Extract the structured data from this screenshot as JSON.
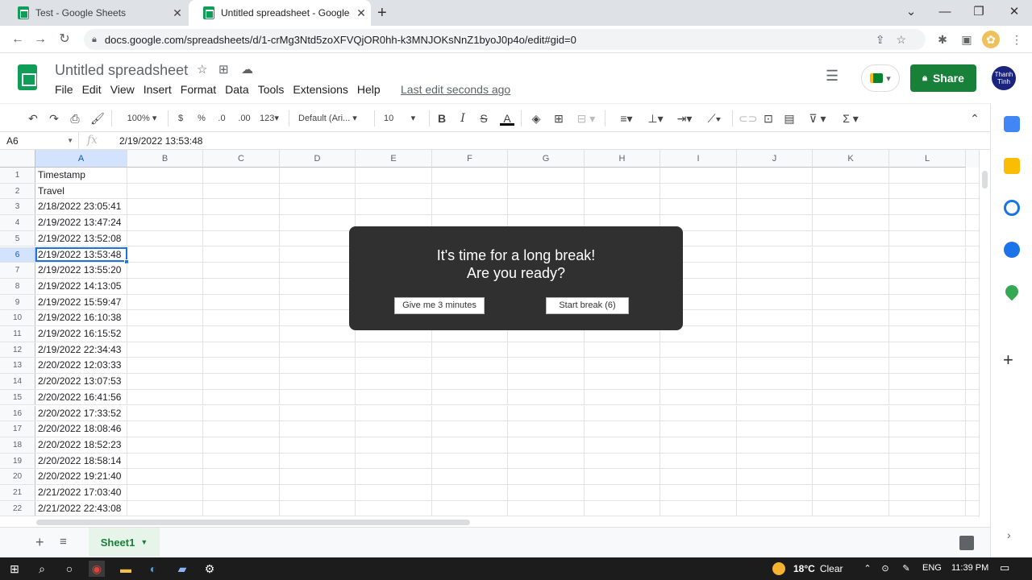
{
  "browser": {
    "tabs": [
      {
        "title": "Test - Google Sheets",
        "active": false
      },
      {
        "title": "Untitled spreadsheet - Google Sh",
        "active": true
      }
    ],
    "url": "docs.google.com/spreadsheets/d/1-crMg3Ntd5zoXFVQjOR0hh-k3MNJOKsNnZ1byoJ0p4o/edit#gid=0"
  },
  "sheets": {
    "title": "Untitled spreadsheet",
    "menu": [
      "File",
      "Edit",
      "View",
      "Insert",
      "Format",
      "Data",
      "Tools",
      "Extensions",
      "Help"
    ],
    "last_edit": "Last edit seconds ago",
    "share_label": "Share",
    "avatar_text": "Thanh Tình"
  },
  "toolbar": {
    "zoom": "100%",
    "currency": "$",
    "percent": "%",
    "dec_decrease": ".0",
    "dec_increase": ".00",
    "more_formats": "123",
    "font": "Default (Ari...",
    "font_size": "10",
    "bold": "B",
    "italic": "I",
    "strike": "S",
    "text_color": "A",
    "sum": "Σ"
  },
  "formula_bar": {
    "cell_ref": "A6",
    "fx": "fx",
    "value": "2/19/2022 13:53:48"
  },
  "grid": {
    "columns": [
      "A",
      "B",
      "C",
      "D",
      "E",
      "F",
      "G",
      "H",
      "I",
      "J",
      "K",
      "L"
    ],
    "selected_column": "A",
    "selected_row": 6,
    "rows": [
      {
        "num": "1",
        "a": "Timestamp"
      },
      {
        "num": "2",
        "a": "Travel"
      },
      {
        "num": "3",
        "a": "2/18/2022 23:05:41"
      },
      {
        "num": "4",
        "a": "2/19/2022 13:47:24"
      },
      {
        "num": "5",
        "a": "2/19/2022 13:52:08"
      },
      {
        "num": "6",
        "a": "2/19/2022 13:53:48"
      },
      {
        "num": "7",
        "a": "2/19/2022 13:55:20"
      },
      {
        "num": "8",
        "a": "2/19/2022 14:13:05"
      },
      {
        "num": "9",
        "a": "2/19/2022 15:59:47"
      },
      {
        "num": "10",
        "a": "2/19/2022 16:10:38"
      },
      {
        "num": "11",
        "a": "2/19/2022 16:15:52"
      },
      {
        "num": "12",
        "a": "2/19/2022 22:34:43"
      },
      {
        "num": "13",
        "a": "2/20/2022 12:03:33"
      },
      {
        "num": "14",
        "a": "2/20/2022 13:07:53"
      },
      {
        "num": "15",
        "a": "2/20/2022 16:41:56"
      },
      {
        "num": "16",
        "a": "2/20/2022 17:33:52"
      },
      {
        "num": "17",
        "a": "2/20/2022 18:08:46"
      },
      {
        "num": "18",
        "a": "2/20/2022 18:52:23"
      },
      {
        "num": "19",
        "a": "2/20/2022 18:58:14"
      },
      {
        "num": "20",
        "a": "2/20/2022 19:21:40"
      },
      {
        "num": "21",
        "a": "2/21/2022 17:03:40"
      },
      {
        "num": "22",
        "a": "2/21/2022 22:43:08"
      }
    ]
  },
  "sheet_tabs": {
    "active": "Sheet1"
  },
  "popup": {
    "line1": "It's time for a long break!",
    "line2": "Are you ready?",
    "snooze_label": "Give me 3 minutes",
    "start_label": "Start break (6)"
  },
  "taskbar": {
    "weather": "18°C",
    "weather_desc": "Clear",
    "lang": "ENG",
    "time": "11:39 PM"
  },
  "colors": {
    "share_green": "#188038",
    "sheets_green": "#0f9d58",
    "selection_blue": "#1a73e8",
    "popup_bg": "#303030"
  }
}
